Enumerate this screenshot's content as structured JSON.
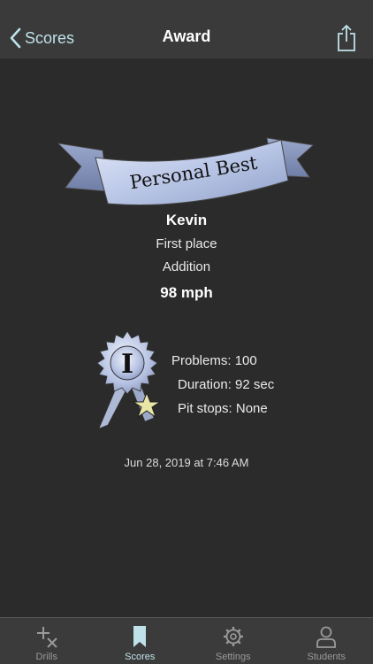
{
  "nav": {
    "back_label": "Scores",
    "title": "Award"
  },
  "award": {
    "banner_text": "Personal Best",
    "rank_numeral": "I",
    "student_name": "Kevin",
    "place": "First place",
    "operation": "Addition",
    "speed": "98 mph"
  },
  "stats": {
    "problems": "Problems: 100",
    "duration": "Duration: 92 sec",
    "pit_stops": "Pit stops: None"
  },
  "date": "Jun 28, 2019 at 7:46 AM",
  "tabs": [
    {
      "label": "Drills",
      "icon": "plus-times-icon"
    },
    {
      "label": "Scores",
      "icon": "bookmark-icon",
      "active": true
    },
    {
      "label": "Settings",
      "icon": "gear-icon"
    },
    {
      "label": "Students",
      "icon": "person-icon"
    }
  ],
  "colors": {
    "accent": "#bfe2ea",
    "ribbon": "#b9c6e6",
    "star": "#e9e6a6",
    "background": "#2b2b2b"
  }
}
